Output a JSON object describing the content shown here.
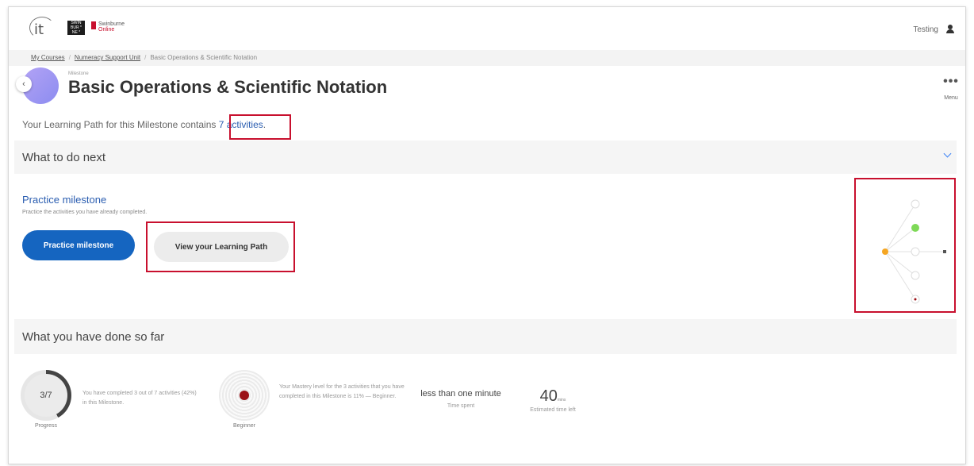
{
  "header": {
    "logo_it": "it",
    "logo_swin": "SWIN BUR * NE *",
    "logo_so_1": "Swinburne",
    "logo_so_2": "Online",
    "user_name": "Testing"
  },
  "breadcrumb": [
    "My Courses",
    "Numeracy Support Unit",
    "Basic Operations & Scientific Notation"
  ],
  "milestone": {
    "kicker": "Milestone",
    "title": "Basic Operations & Scientific Notation",
    "menu_label": "Menu",
    "menu_dots": "•••"
  },
  "learning_path": {
    "text": "Your Learning Path for this Milestone contains ",
    "activities_link": "7 activities",
    "period": "."
  },
  "next": {
    "heading": "What to do next",
    "practice_title": "Practice milestone",
    "practice_desc": "Practice the activities you have already completed.",
    "practice_button": "Practice milestone",
    "view_path_button": "View your Learning Path"
  },
  "done": {
    "heading": "What you have done so far",
    "progress_value": "3/7",
    "progress_fraction": 0.42,
    "progress_label": "Progress",
    "progress_desc": "You have completed 3 out of 7 activities (42%) in this Milestone.",
    "mastery_label": "Beginner",
    "mastery_desc": "Your Mastery level for the 3 activities that you have completed in this Milestone is 11% — Beginner.",
    "time_spent_value": "less than one minute",
    "time_spent_label": "Time spent",
    "estimated_value": "40",
    "estimated_unit": "mins",
    "estimated_label": "Estimated time left"
  },
  "colors": {
    "primary_button": "#1565c0",
    "link": "#2a5db0",
    "highlight": "#c8102e",
    "mastery_dot": "#9b1117",
    "graph_start": "#f5a623",
    "graph_done": "#7ed957"
  }
}
